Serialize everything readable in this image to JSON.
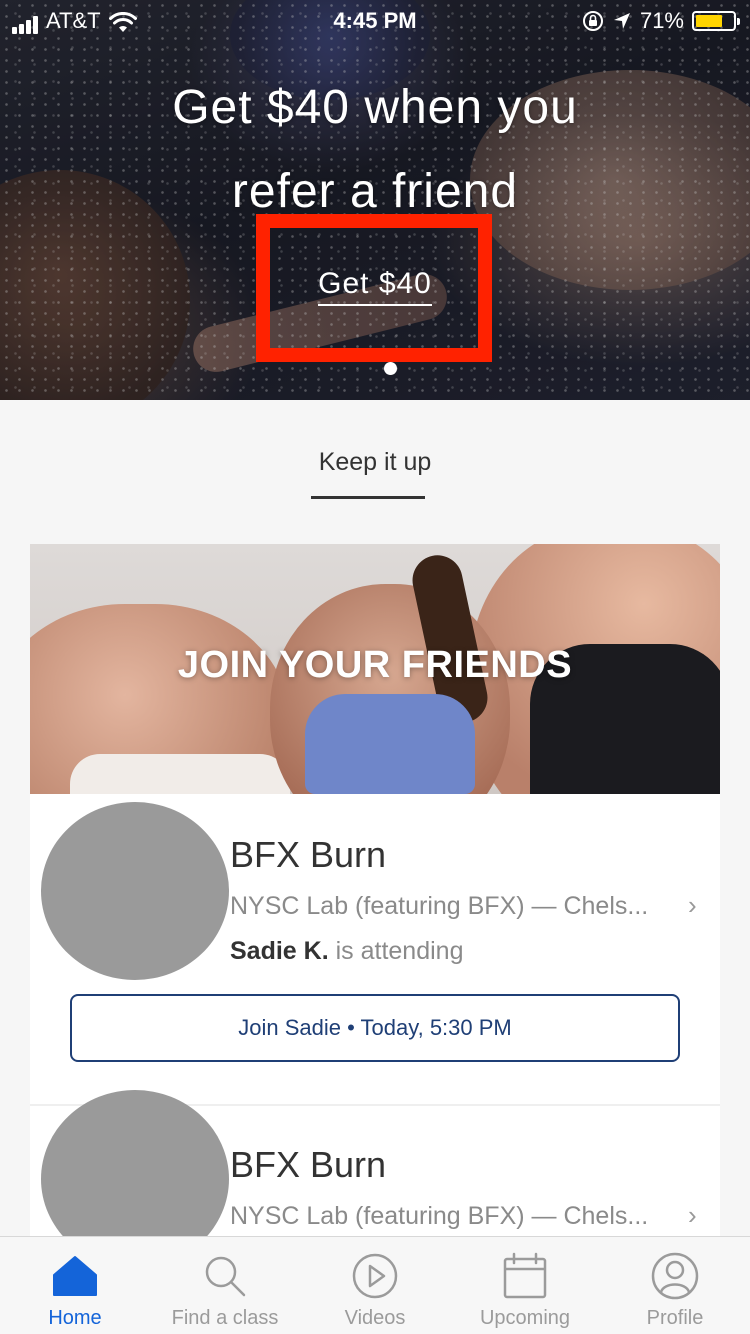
{
  "status_bar": {
    "carrier": "AT&T",
    "time": "4:45 PM",
    "battery": "71%",
    "battery_level": 0.71,
    "battery_color": "#ffd400"
  },
  "hero": {
    "title_line1": "Get $40 when you",
    "title_line2": "refer a friend",
    "cta_label": "Get $40",
    "highlight_color": "#ff2200"
  },
  "section": {
    "title": "Keep it up"
  },
  "join_banner": {
    "title": "JOIN YOUR FRIENDS"
  },
  "classes": [
    {
      "name": "BFX Burn",
      "location": "NYSC Lab (featuring BFX) — Chels...",
      "friend": "Sadie K.",
      "attending_text": "is attending",
      "join_label": "Join Sadie • Today, 5:30 PM"
    },
    {
      "name": "BFX Burn",
      "location": "NYSC Lab (featuring BFX) — Chels..."
    }
  ],
  "tabs": [
    {
      "label": "Home",
      "icon": "home-icon",
      "active": true
    },
    {
      "label": "Find a class",
      "icon": "search-icon",
      "active": false
    },
    {
      "label": "Videos",
      "icon": "play-icon",
      "active": false
    },
    {
      "label": "Upcoming",
      "icon": "calendar-icon",
      "active": false
    },
    {
      "label": "Profile",
      "icon": "profile-icon",
      "active": false
    }
  ],
  "colors": {
    "accent": "#1464d9",
    "button_border": "#1f3f76",
    "inactive_tab": "#9b9b9b"
  }
}
